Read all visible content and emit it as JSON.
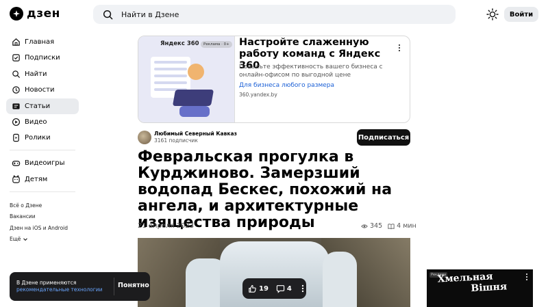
{
  "header": {
    "logo_text": "дзен",
    "search_placeholder": "Найти в Дзене",
    "login_label": "Войти"
  },
  "sidebar": {
    "items": [
      {
        "label": "Главная",
        "icon": "home-icon"
      },
      {
        "label": "Подписки",
        "icon": "subscriptions-icon"
      },
      {
        "label": "Найти",
        "icon": "search-icon"
      },
      {
        "label": "Новости",
        "icon": "news-icon"
      },
      {
        "label": "Статьи",
        "icon": "articles-icon",
        "active": true
      },
      {
        "label": "Видео",
        "icon": "video-icon"
      },
      {
        "label": "Ролики",
        "icon": "shorts-icon"
      }
    ],
    "items2": [
      {
        "label": "Видеоигры",
        "icon": "gamepad-icon"
      },
      {
        "label": "Детям",
        "icon": "kids-icon"
      }
    ],
    "footer": {
      "about": "Всё о Дзене",
      "jobs": "Вакансии",
      "apps": "Дзен на iOS и Android",
      "more": "Ещё"
    }
  },
  "ad": {
    "brand": "Яндекс 360",
    "badge": "Реклама · 0+",
    "title": "Настройте слаженную работу команд с Яндекс 360",
    "description": "Повысьте эффективность вашего бизнеса с онлайн-офисом по выгодной цене",
    "link": "Для бизнеса любого размера",
    "domain": "360.yandex.by"
  },
  "channel": {
    "name": "Любимый Северный Кавказ",
    "subscribers": "3161 подписчик",
    "subscribe_label": "Подписаться"
  },
  "article": {
    "title": "Февральская прогулка в Курджиново. Замерзший водопад Бескес, похожий на ангела, и архитектурные изящества природы",
    "date": "21 апреля 2023",
    "views": "345",
    "read_time": "4 мин"
  },
  "cookie": {
    "text": "В Дзене применяются",
    "link": "рекомендательные технологии",
    "button": "Понятно"
  },
  "reactions": {
    "likes": "19",
    "comments": "4"
  },
  "side_ad": {
    "tag": "Реклама",
    "line1": "Хмельная",
    "line2": "Вішня"
  }
}
